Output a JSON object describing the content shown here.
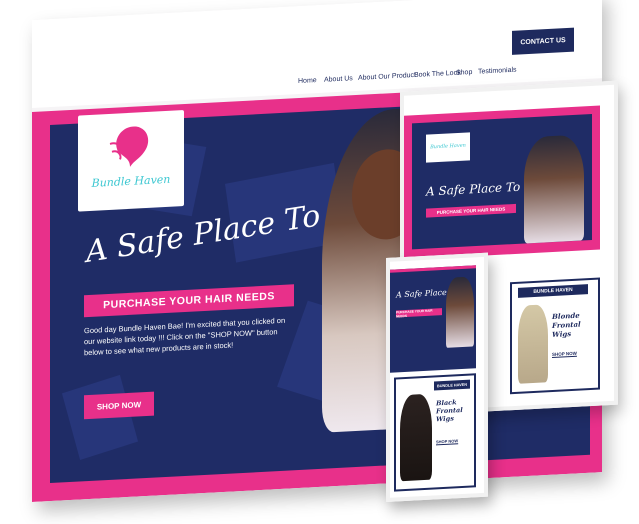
{
  "colors": {
    "brand_pink": "#e8308a",
    "brand_navy": "#1e2a5e",
    "logo_teal": "#3cc7d1"
  },
  "logo": {
    "text": "Bundle Haven"
  },
  "nav": {
    "items": [
      "Home",
      "About Us",
      "About Our Product",
      "Book The Look",
      "Shop",
      "Testimonials"
    ],
    "contact": "CONTACT US"
  },
  "hero": {
    "title": "A Safe Place To",
    "badge": "PURCHASE YOUR HAIR NEEDS",
    "body": "Good day Bundle Haven Bae! I'm excited that you clicked on our website link today !!! Click on the \"SHOP NOW\" button below to see what new products are in stock!",
    "cta": "SHOP NOW"
  },
  "tablet_card": {
    "label": "BUNDLE HAVEN",
    "title": "Blonde Frontal Wigs",
    "link": "SHOP NOW"
  },
  "phone_card": {
    "label": "BUNDLE HAVEN",
    "title": "Black Frontal Wigs",
    "link": "SHOP NOW"
  }
}
